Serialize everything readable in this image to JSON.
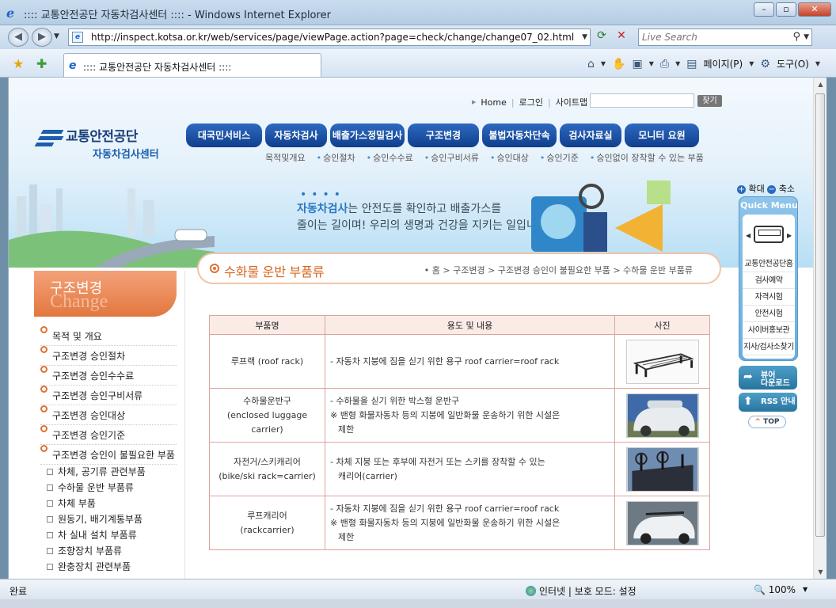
{
  "window": {
    "title": ":::: 교통안전공단 자동차검사센터 :::: - Windows Internet Explorer",
    "minimize_glyph": "–",
    "maximize_glyph": "▫",
    "close_glyph": "✕"
  },
  "address": {
    "url": "http://inspect.kotsa.or.kr/web/services/page/viewPage.action?page=check/change/change07_02.html",
    "search_placeholder": "Live Search"
  },
  "tab": {
    "label": ":::: 교통안전공단 자동차검사센터 ::::"
  },
  "commandbar": {
    "page_label": "페이지(P)",
    "tools_label": "도구(O)"
  },
  "site": {
    "top_links": [
      "Home",
      "로그인",
      "사이트맵"
    ],
    "find_button": "찾기",
    "logo_name": "교통안전공단",
    "logo_sub": "자동차검사센터",
    "main_nav": [
      "대국민서비스",
      "자동차검사",
      "배출가스정밀검사",
      "구조변경",
      "불법자동차단속",
      "검사자료실",
      "모니터 요원"
    ],
    "sub_nav": [
      "목적및개요",
      "승인절차",
      "승인수수료",
      "승인구비서류",
      "승인대상",
      "승인기준",
      "승인없이 장착할 수 있는 부품"
    ],
    "banner_line1_highlight": "자동차검사",
    "banner_line1_rest": "는 안전도를 확인하고 배출가스를",
    "banner_line2": "줄이는 길이며! 우리의 생명과 건강을 지키는 일입니다.",
    "zoom_in": "확대",
    "zoom_out": "축소",
    "quick_menu_title": "Quick Menu",
    "quick_menu_items": [
      "교통안전공단홈",
      "검사예약",
      "자격시험",
      "안전시험",
      "사이버홍보관",
      "지사/검사소찾기"
    ],
    "viewer_download": [
      "뷰어",
      "다운로드"
    ],
    "rss": "RSS 안내",
    "top": "TOP"
  },
  "left": {
    "heading_ko": "구조변경",
    "heading_en": "Change",
    "menu": [
      "목적 및 개요",
      "구조변경 승인절차",
      "구조변경 승인수수료",
      "구조변경 승인구비서류",
      "구조변경 승인대상",
      "구조변경 승인기준",
      "구조변경 승인이 불필요한 부품"
    ],
    "submenu": [
      "차체, 공기류 관련부품",
      "수하물 운반 부품류",
      "차체 부품",
      "원동기, 배기계통부품",
      "차 실내 설치 부품류",
      "조향장치 부품류",
      "완충장치 관련부품"
    ]
  },
  "content": {
    "title": "수화물 운반 부품류",
    "breadcrumb": "• 홈 > 구조변경 > 구조변경 승인이 불필요한 부품 > 수하물 운반 부품류",
    "table_headers": [
      "부품명",
      "용도 및 내용",
      "사진"
    ],
    "rows": [
      {
        "name1": "루프랙 (roof rack)",
        "name2": "",
        "name3": "",
        "d1": "- 자동차 지붕에 짐을 싣기 위한 용구 roof carrier=roof rack",
        "d2": "",
        "d3": ""
      },
      {
        "name1": "수하물운반구",
        "name2": "(enclosed luggage",
        "name3": "carrier)",
        "d1": "- 수하물을 싣기 위한 박스형 운반구",
        "d2": "※ 밴형 화물자동차 등의 지붕에 일반화물 운송하기 위한 시설은",
        "d3": "제한"
      },
      {
        "name1": "자전거/스키캐리어",
        "name2": "(bike/ski rack=carrier)",
        "name3": "",
        "d1": "- 차체 지붕 또는 후부에 자전거 또는 스키를 장착할 수 있는",
        "d2": "캐리어(carrier)",
        "d3": ""
      },
      {
        "name1": "루프캐리어",
        "name2": "(rackcarrier)",
        "name3": "",
        "d1": "- 자동차 지붕에 짐을 싣기 위한 용구 roof carrier=roof rack",
        "d2": "※ 밴형 화물자동차 등의 지붕에 일반화물 운송하기 위한 시설은",
        "d3": "제한"
      }
    ]
  },
  "status": {
    "text": "완료",
    "zone": "인터넷 | 보호 모드: 설정",
    "zoom": "100%"
  }
}
